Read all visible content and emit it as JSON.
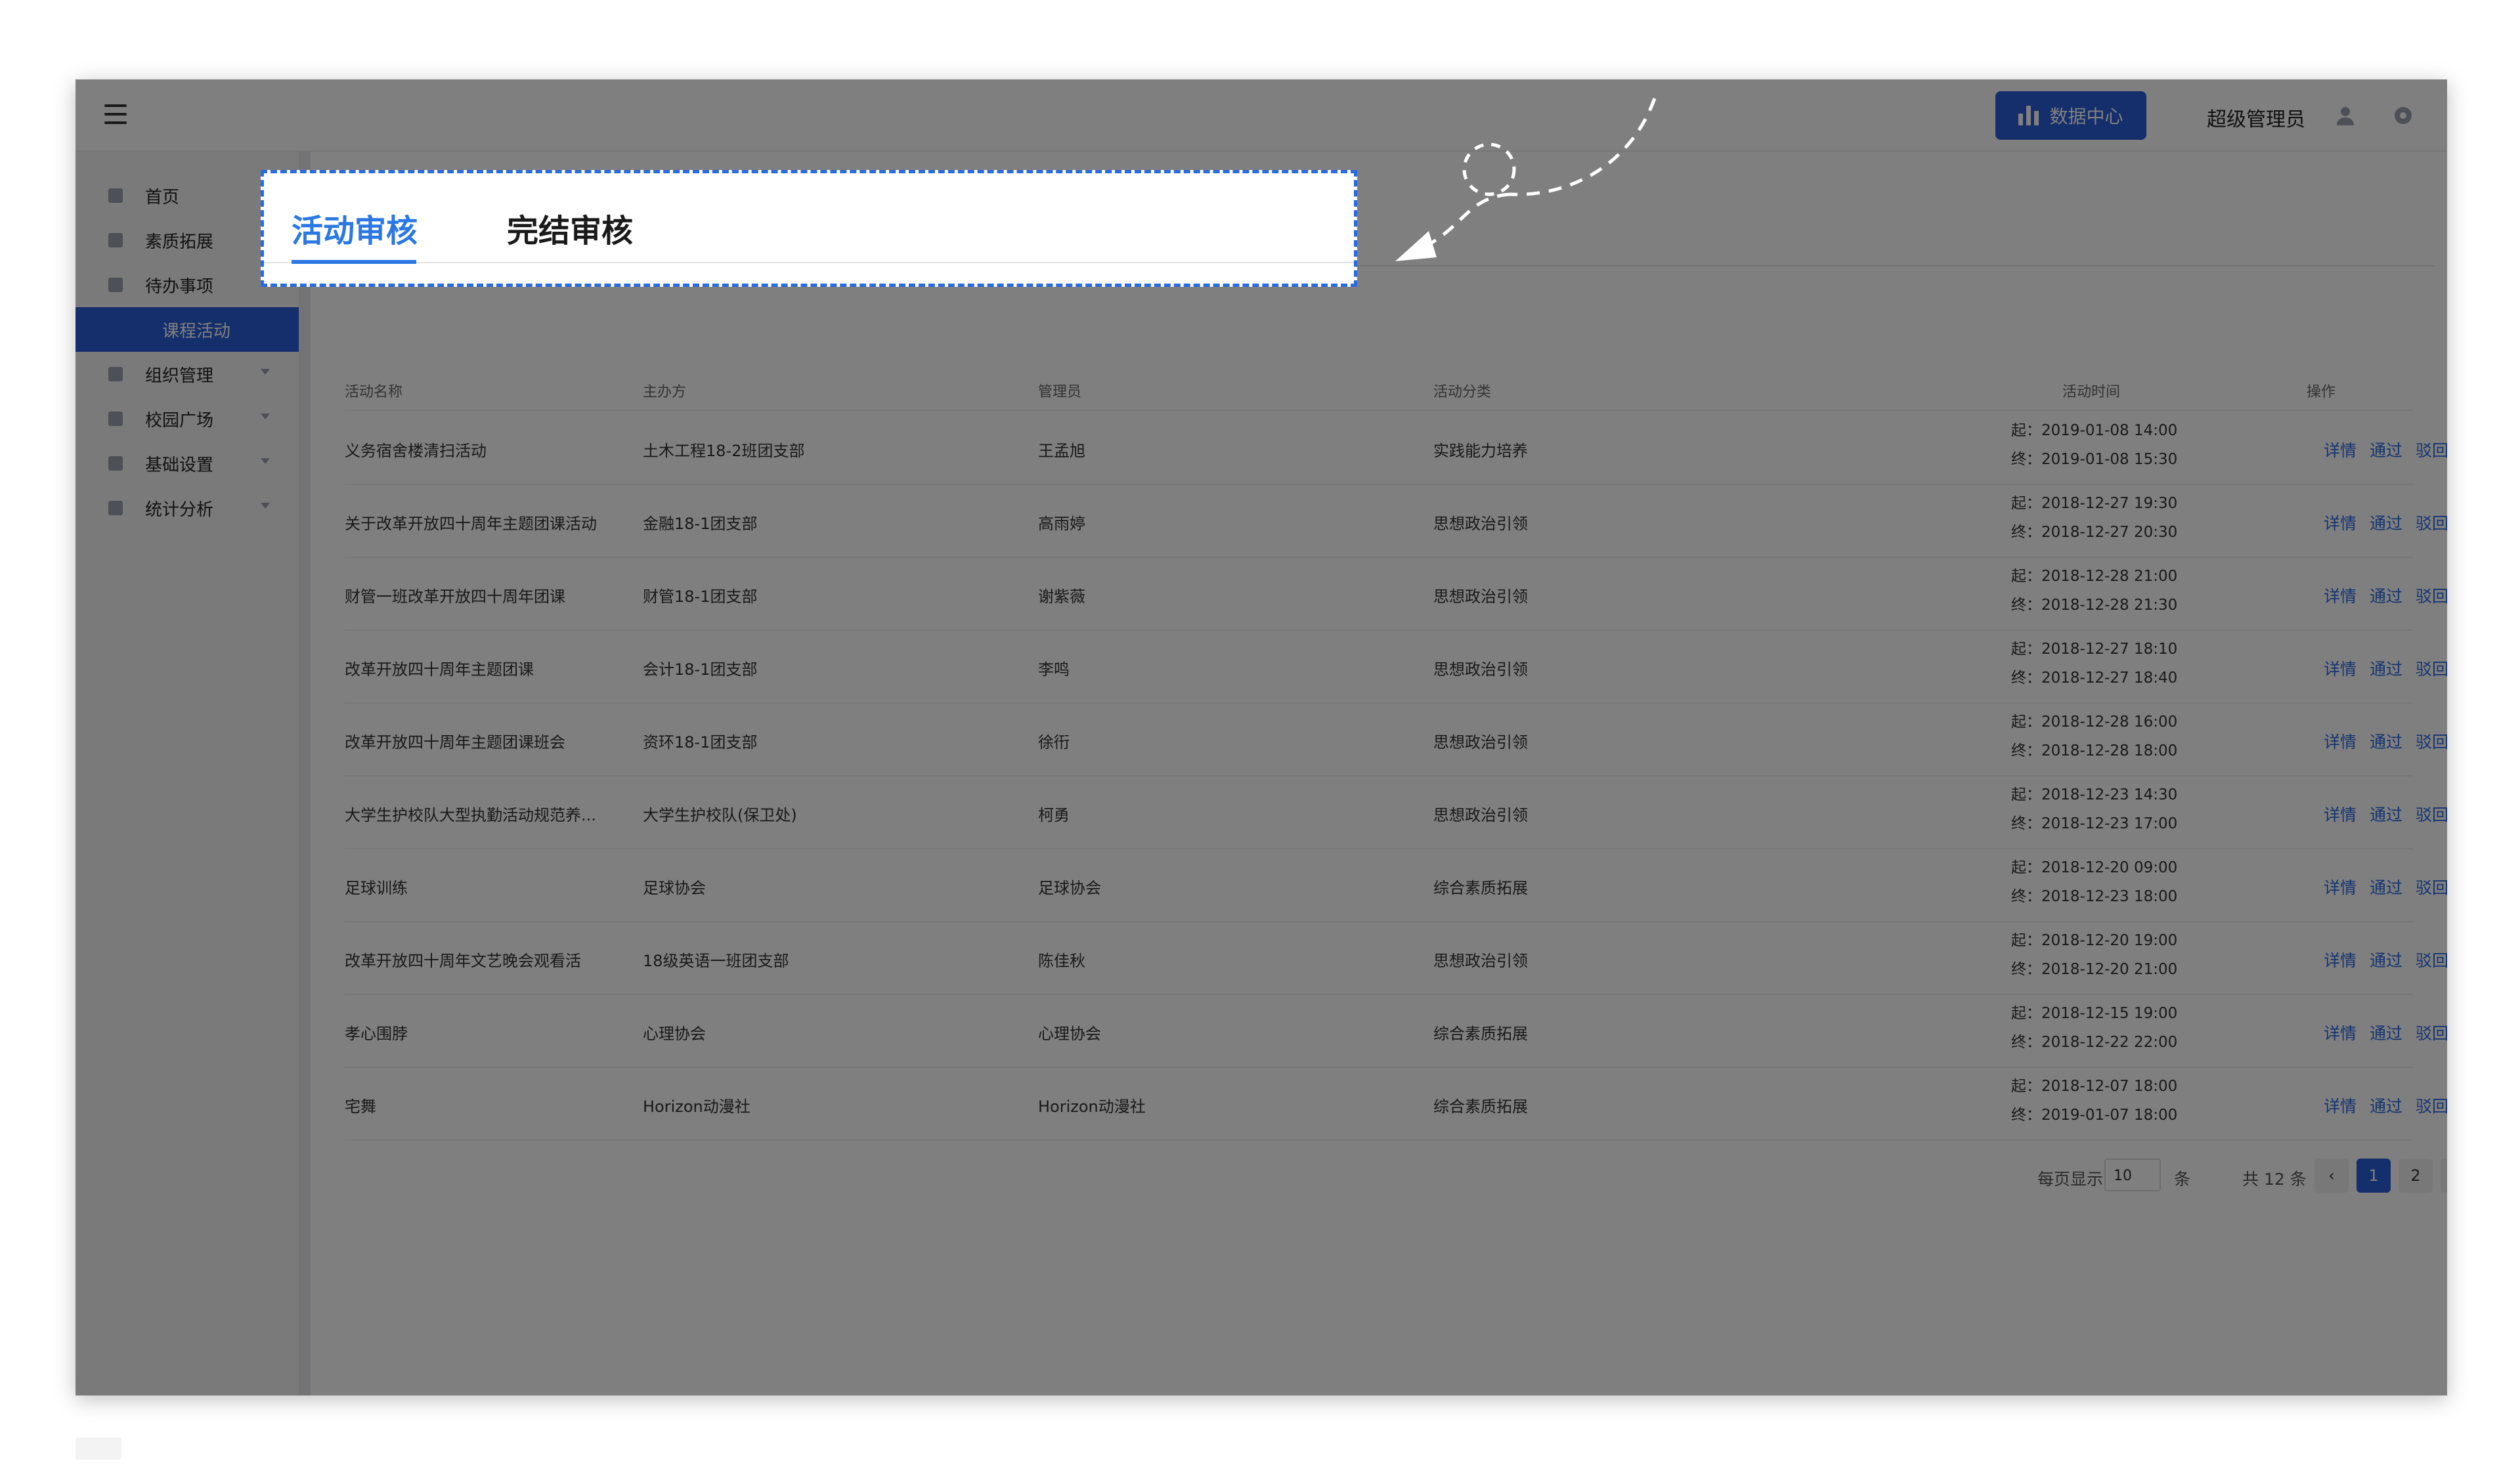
{
  "topbar": {
    "data_center_label": "数据中心",
    "admin_name": "超级管理员"
  },
  "sidebar": {
    "items": [
      {
        "label": "首页",
        "has_caret": false
      },
      {
        "label": "素质拓展",
        "has_caret": false
      },
      {
        "label": "待办事项",
        "has_caret": false
      },
      {
        "label": "组织管理",
        "has_caret": true
      },
      {
        "label": "校园广场",
        "has_caret": true
      },
      {
        "label": "基础设置",
        "has_caret": true
      },
      {
        "label": "统计分析",
        "has_caret": true
      }
    ],
    "active_sub": "课程活动"
  },
  "tabs": {
    "active": "活动审核",
    "inactive": "完结审核"
  },
  "table": {
    "headers": [
      "活动名称",
      "主办方",
      "管理员",
      "活动分类",
      "活动时间",
      "操作"
    ],
    "rows": [
      {
        "name": "义务宿舍楼清扫活动",
        "host": "土木工程18-2班团支部",
        "admin": "王孟旭",
        "category": "实践能力培养",
        "start": "起：2019-01-08 14:00",
        "end": "终：2019-01-08 15:30"
      },
      {
        "name": "关于改革开放四十周年主题团课活动",
        "host": "金融18-1团支部",
        "admin": "高雨婷",
        "category": "思想政治引领",
        "start": "起：2018-12-27 19:30",
        "end": "终：2018-12-27 20:30"
      },
      {
        "name": "财管一班改革开放四十周年团课",
        "host": "财管18-1团支部",
        "admin": "谢紫薇",
        "category": "思想政治引领",
        "start": "起：2018-12-28 21:00",
        "end": "终：2018-12-28 21:30"
      },
      {
        "name": "改革开放四十周年主题团课",
        "host": "会计18-1团支部",
        "admin": "李鸣",
        "category": "思想政治引领",
        "start": "起：2018-12-27 18:10",
        "end": "终：2018-12-27 18:40"
      },
      {
        "name": "改革开放四十周年主题团课班会",
        "host": "资环18-1团支部",
        "admin": "徐衎",
        "category": "思想政治引领",
        "start": "起：2018-12-28 16:00",
        "end": "终：2018-12-28 18:00"
      },
      {
        "name": "大学生护校队大型执勤活动规范养...",
        "host": "大学生护校队(保卫处)",
        "admin": "柯勇",
        "category": "思想政治引领",
        "start": "起：2018-12-23 14:30",
        "end": "终：2018-12-23 17:00"
      },
      {
        "name": "足球训练",
        "host": "足球协会",
        "admin": "足球协会",
        "category": "综合素质拓展",
        "start": "起：2018-12-20 09:00",
        "end": "终：2018-12-23 18:00"
      },
      {
        "name": "改革开放四十周年文艺晚会观看活",
        "host": "18级英语一班团支部",
        "admin": "陈佳秋",
        "category": "思想政治引领",
        "start": "起：2018-12-20 19:00",
        "end": "终：2018-12-20 21:00"
      },
      {
        "name": "孝心围脖",
        "host": "心理协会",
        "admin": "心理协会",
        "category": "综合素质拓展",
        "start": "起：2018-12-15 19:00",
        "end": "终：2018-12-22 22:00"
      },
      {
        "name": "宅舞",
        "host": "Horizon动漫社",
        "admin": "Horizon动漫社",
        "category": "综合素质拓展",
        "start": "起：2018-12-07 18:00",
        "end": "终：2019-01-07 18:00"
      }
    ],
    "actions": [
      "详情",
      "通过",
      "驳回"
    ]
  },
  "pager": {
    "per_page_label": "每页显示",
    "per_page_value": "10",
    "unit": "条",
    "total": "共 12 条",
    "pages": [
      "1",
      "2"
    ],
    "current": "1",
    "prev": "‹",
    "next": "›"
  },
  "colors": {
    "accent": "#2b5fd9",
    "tab_active": "#2b78e4",
    "link": "#2b6be0"
  }
}
